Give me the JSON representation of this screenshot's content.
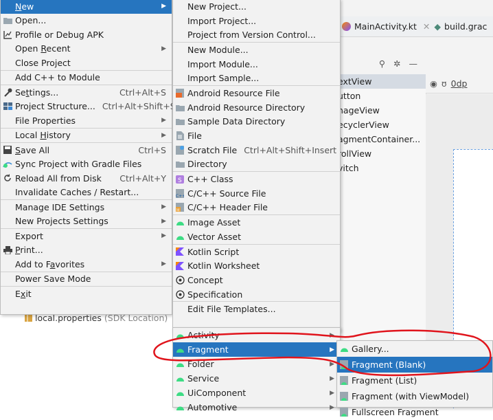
{
  "editor": {
    "tabs": [
      {
        "label": "MainActivity.kt",
        "icon": "kotlin-file-icon"
      },
      {
        "label": "build.grac",
        "icon": "gradle-file-icon"
      }
    ],
    "palette_items": [
      "extView",
      "utton",
      "nageView",
      "ecyclerView",
      "agmentContainer...",
      "rollView",
      "vitch"
    ],
    "design_value": "0dp",
    "project_file": {
      "name": "local.properties",
      "hint": "(SDK Location)"
    }
  },
  "file_menu": [
    {
      "label": "New",
      "submenu": true,
      "selected": true,
      "icon": "none"
    },
    {
      "label": "Open...",
      "icon": "folder-icon"
    },
    {
      "label": "Profile or Debug APK",
      "icon": "profile-icon"
    },
    {
      "label": "Open Recent",
      "submenu": true
    },
    {
      "label": "Close Project"
    },
    {
      "sep": true
    },
    {
      "label": "Add C++ to Module"
    },
    {
      "sep": true
    },
    {
      "label": "Settings...",
      "shortcut": "Ctrl+Alt+S",
      "icon": "wrench-icon"
    },
    {
      "label": "Project Structure...",
      "shortcut": "Ctrl+Alt+Shift+S",
      "icon": "project-structure-icon"
    },
    {
      "label": "File Properties",
      "submenu": true
    },
    {
      "sep": true
    },
    {
      "label": "Local History",
      "submenu": true
    },
    {
      "sep": true
    },
    {
      "label": "Save All",
      "shortcut": "Ctrl+S",
      "icon": "save-icon"
    },
    {
      "label": "Sync Project with Gradle Files",
      "icon": "sync-icon"
    },
    {
      "label": "Reload All from Disk",
      "shortcut": "Ctrl+Alt+Y",
      "icon": "reload-icon"
    },
    {
      "label": "Invalidate Caches / Restart..."
    },
    {
      "sep": true
    },
    {
      "label": "Manage IDE Settings",
      "submenu": true
    },
    {
      "label": "New Projects Settings",
      "submenu": true
    },
    {
      "sep": true
    },
    {
      "label": "Export",
      "submenu": true
    },
    {
      "label": "Print...",
      "icon": "print-icon"
    },
    {
      "label": "Add to Favorites",
      "submenu": true
    },
    {
      "sep": true
    },
    {
      "label": "Power Save Mode"
    },
    {
      "sep": true
    },
    {
      "label": "Exit"
    }
  ],
  "new_menu": [
    {
      "label": "New Project..."
    },
    {
      "label": "Import Project..."
    },
    {
      "label": "Project from Version Control..."
    },
    {
      "sep": true
    },
    {
      "label": "New Module..."
    },
    {
      "label": "Import Module..."
    },
    {
      "label": "Import Sample..."
    },
    {
      "sep": true
    },
    {
      "label": "Android Resource File",
      "icon": "android-resource-file-icon"
    },
    {
      "label": "Android Resource Directory",
      "icon": "folder-icon"
    },
    {
      "label": "Sample Data Directory",
      "icon": "folder-icon"
    },
    {
      "label": "File",
      "icon": "file-icon"
    },
    {
      "label": "Scratch File",
      "shortcut": "Ctrl+Alt+Shift+Insert",
      "icon": "scratch-file-icon"
    },
    {
      "label": "Directory",
      "icon": "folder-icon"
    },
    {
      "sep": true
    },
    {
      "label": "C++ Class",
      "icon": "cpp-class-icon"
    },
    {
      "label": "C/C++ Source File",
      "icon": "cpp-source-icon"
    },
    {
      "label": "C/C++ Header File",
      "icon": "cpp-header-icon"
    },
    {
      "sep": true
    },
    {
      "label": "Image Asset",
      "icon": "android-icon"
    },
    {
      "label": "Vector Asset",
      "icon": "android-icon"
    },
    {
      "sep": true
    },
    {
      "label": "Kotlin Script",
      "icon": "kotlin-icon"
    },
    {
      "label": "Kotlin Worksheet",
      "icon": "kotlin-icon"
    },
    {
      "label": "Concept",
      "icon": "concept-icon"
    },
    {
      "label": "Specification",
      "icon": "concept-icon"
    },
    {
      "sep": true
    },
    {
      "label": "Edit File Templates..."
    }
  ],
  "android_menu": [
    {
      "label": "Activity",
      "submenu": true,
      "icon": "android-icon"
    },
    {
      "label": "Fragment",
      "submenu": true,
      "selected": true,
      "icon": "android-icon"
    },
    {
      "label": "Folder",
      "submenu": true,
      "icon": "android-icon"
    },
    {
      "label": "Service",
      "submenu": true,
      "icon": "android-icon"
    },
    {
      "label": "UiComponent",
      "submenu": true,
      "icon": "android-icon"
    },
    {
      "label": "Automotive",
      "submenu": true,
      "icon": "android-icon"
    }
  ],
  "fragment_menu": [
    {
      "label": "Gallery...",
      "icon": "android-icon"
    },
    {
      "label": "Fragment (Blank)",
      "selected": true,
      "icon": "fragment-icon"
    },
    {
      "label": "Fragment (List)",
      "icon": "fragment-icon"
    },
    {
      "label": "Fragment (with ViewModel)",
      "icon": "fragment-icon"
    },
    {
      "label": "Fullscreen Fragment",
      "icon": "fragment-icon"
    }
  ],
  "colors": {
    "selection": "#2675bf",
    "menu_bg": "#f2f2f2",
    "annotation": "#e0141c",
    "android_green": "#3ddc84"
  }
}
